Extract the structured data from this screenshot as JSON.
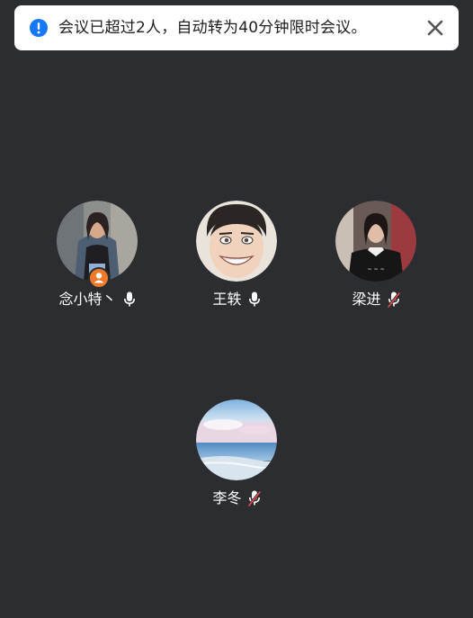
{
  "banner": {
    "icon": "info-icon",
    "message": "会议已超过2人，自动转为40分钟限时会议。",
    "close_icon": "close-icon",
    "accent_color": "#1677ff"
  },
  "participants": [
    {
      "name": "念小特丶",
      "mic": "mic-on-icon",
      "host": true,
      "avatar": "avatar-photo-woman-denim"
    },
    {
      "name": "王轶",
      "mic": "mic-on-icon",
      "host": false,
      "avatar": "avatar-cartoon-smiling-man"
    },
    {
      "name": "梁进",
      "mic": "mic-muted-icon",
      "host": false,
      "avatar": "avatar-photo-woman-dark-sweater"
    },
    {
      "name": "李冬",
      "mic": "mic-muted-icon",
      "host": false,
      "avatar": "avatar-photo-beach-sky"
    }
  ],
  "colors": {
    "background": "#2b2d30",
    "host_badge": "#f07a2a",
    "muted_slash": "#e5484d"
  }
}
